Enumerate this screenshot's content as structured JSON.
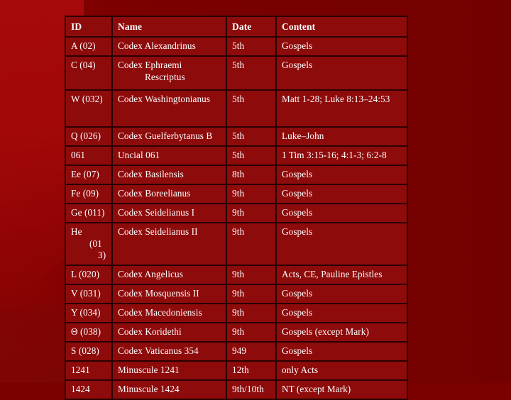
{
  "slide": {
    "background_color": "#7b0000",
    "accent_color": "#a80a0a",
    "table_cell_color": "#8e0b0b",
    "table_border_color": "#2a0000",
    "text_color": "#ffffff"
  },
  "table": {
    "columns": [
      "ID",
      "Name",
      "Date",
      "Content"
    ],
    "rows": [
      {
        "id": "A (02)",
        "name": "Codex Alexandrinus",
        "date": "5th",
        "content": "Gospels"
      },
      {
        "id": "C (04)",
        "name_line1": "Codex Ephraemi",
        "name_line2": "Rescriptus",
        "name": "Codex Ephraemi Rescriptus",
        "date": "5th",
        "content": "Gospels"
      },
      {
        "id": "W (032)",
        "name": "Codex Washingtonianus",
        "date": "5th",
        "content": "Matt 1-28; Luke 8:13–24:53"
      },
      {
        "id": "Q (026)",
        "name": "Codex Guelferbytanus B",
        "date": "5th",
        "content": "Luke–John"
      },
      {
        "id": "061",
        "name": "Uncial 061",
        "date": "5th",
        "content": "1 Tim 3:15-16; 4:1-3; 6:2-8"
      },
      {
        "id": "Ee (07)",
        "name": "Codex Basilensis",
        "date": "8th",
        "content": "Gospels"
      },
      {
        "id": "Fe (09)",
        "name": "Codex Boreelianus",
        "date": "9th",
        "content": "Gospels"
      },
      {
        "id": "Ge (011)",
        "name": "Codex Seidelianus I",
        "date": "9th",
        "content": "Gospels"
      },
      {
        "id_line1": "He",
        "id_line2": "(01",
        "id_line3": "3)",
        "id": "He (013)",
        "name": "Codex Seidelianus II",
        "date": "9th",
        "content": "Gospels"
      },
      {
        "id": "L (020)",
        "name": "Codex Angelicus",
        "date": "9th",
        "content": "Acts, CE, Pauline Epistles"
      },
      {
        "id": "V (031)",
        "name": "Codex Mosquensis II",
        "date": "9th",
        "content": "Gospels"
      },
      {
        "id": "Y (034)",
        "name": "Codex Macedoniensis",
        "date": "9th",
        "content": "Gospels"
      },
      {
        "id": "Θ (038)",
        "name": "Codex Koridethi",
        "date": "9th",
        "content": "Gospels (except Mark)"
      },
      {
        "id": "S (028)",
        "name": "Codex Vaticanus 354",
        "date": "949",
        "content": "Gospels"
      },
      {
        "id": "1241",
        "name": "Minuscule 1241",
        "date": "12th",
        "content": "only Acts"
      },
      {
        "id": "1424",
        "name": "Minuscule 1424",
        "date": "9th/10th",
        "content": "NT (except Mark)"
      }
    ]
  }
}
